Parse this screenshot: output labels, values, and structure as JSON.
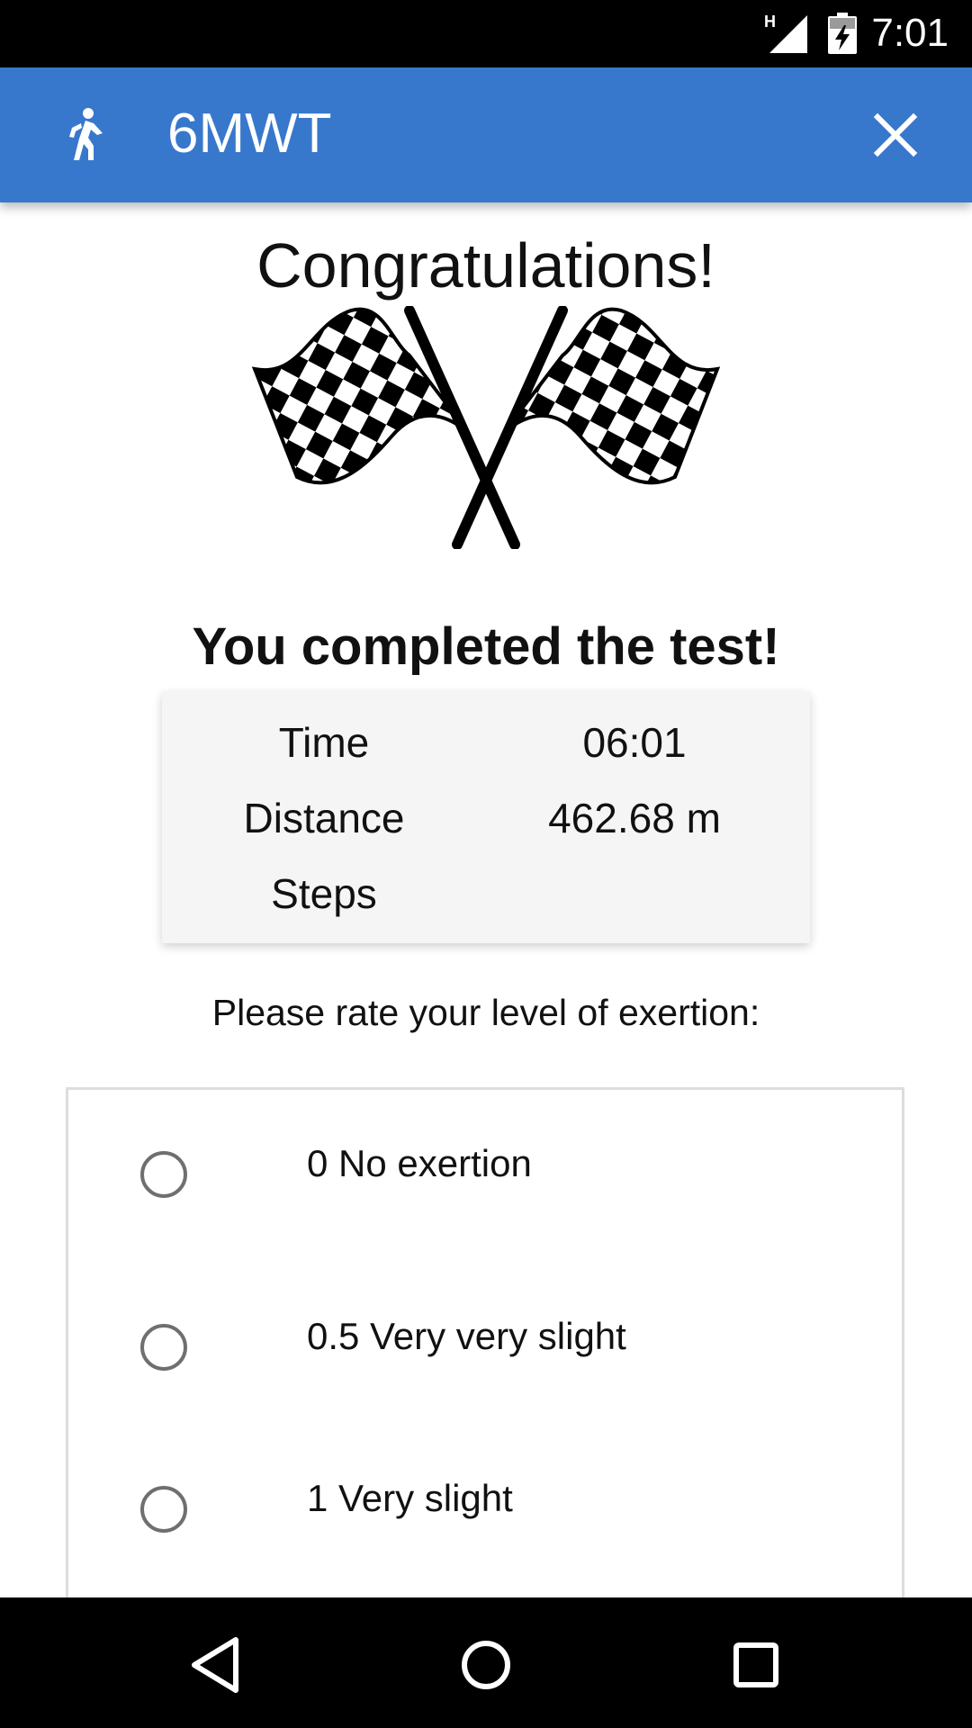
{
  "status_bar": {
    "network": "H",
    "time": "7:01"
  },
  "app_bar": {
    "title": "6MWT",
    "icon": "walking-person-icon",
    "close_icon": "close-icon",
    "color": "#3878CC"
  },
  "main": {
    "congrats": "Congratulations!",
    "completed": "You completed the test!",
    "results": [
      {
        "label": "Time",
        "value": "06:01"
      },
      {
        "label": "Distance",
        "value": "462.68 m"
      },
      {
        "label": "Steps",
        "value": ""
      }
    ],
    "prompt": "Please rate your level of exertion:",
    "options": [
      {
        "label": "0 No exertion",
        "selected": false
      },
      {
        "label": "0.5 Very very slight",
        "selected": false
      },
      {
        "label": "1 Very slight",
        "selected": false
      }
    ]
  },
  "nav_bar": {
    "back_icon": "back-icon",
    "home_icon": "home-icon",
    "recents_icon": "recents-icon"
  }
}
